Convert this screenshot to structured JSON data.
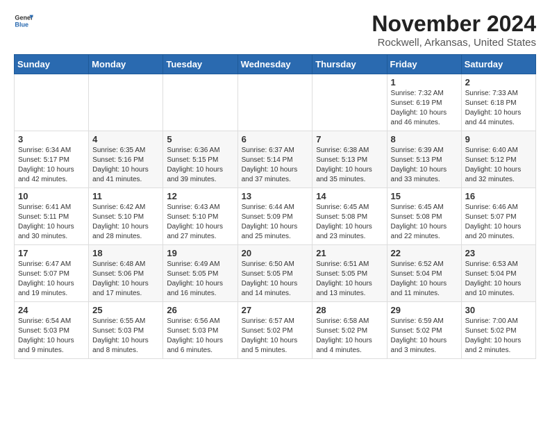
{
  "header": {
    "logo_general": "General",
    "logo_blue": "Blue",
    "month": "November 2024",
    "location": "Rockwell, Arkansas, United States"
  },
  "weekdays": [
    "Sunday",
    "Monday",
    "Tuesday",
    "Wednesday",
    "Thursday",
    "Friday",
    "Saturday"
  ],
  "weeks": [
    [
      {
        "day": "",
        "info": ""
      },
      {
        "day": "",
        "info": ""
      },
      {
        "day": "",
        "info": ""
      },
      {
        "day": "",
        "info": ""
      },
      {
        "day": "",
        "info": ""
      },
      {
        "day": "1",
        "info": "Sunrise: 7:32 AM\nSunset: 6:19 PM\nDaylight: 10 hours\nand 46 minutes."
      },
      {
        "day": "2",
        "info": "Sunrise: 7:33 AM\nSunset: 6:18 PM\nDaylight: 10 hours\nand 44 minutes."
      }
    ],
    [
      {
        "day": "3",
        "info": "Sunrise: 6:34 AM\nSunset: 5:17 PM\nDaylight: 10 hours\nand 42 minutes."
      },
      {
        "day": "4",
        "info": "Sunrise: 6:35 AM\nSunset: 5:16 PM\nDaylight: 10 hours\nand 41 minutes."
      },
      {
        "day": "5",
        "info": "Sunrise: 6:36 AM\nSunset: 5:15 PM\nDaylight: 10 hours\nand 39 minutes."
      },
      {
        "day": "6",
        "info": "Sunrise: 6:37 AM\nSunset: 5:14 PM\nDaylight: 10 hours\nand 37 minutes."
      },
      {
        "day": "7",
        "info": "Sunrise: 6:38 AM\nSunset: 5:13 PM\nDaylight: 10 hours\nand 35 minutes."
      },
      {
        "day": "8",
        "info": "Sunrise: 6:39 AM\nSunset: 5:13 PM\nDaylight: 10 hours\nand 33 minutes."
      },
      {
        "day": "9",
        "info": "Sunrise: 6:40 AM\nSunset: 5:12 PM\nDaylight: 10 hours\nand 32 minutes."
      }
    ],
    [
      {
        "day": "10",
        "info": "Sunrise: 6:41 AM\nSunset: 5:11 PM\nDaylight: 10 hours\nand 30 minutes."
      },
      {
        "day": "11",
        "info": "Sunrise: 6:42 AM\nSunset: 5:10 PM\nDaylight: 10 hours\nand 28 minutes."
      },
      {
        "day": "12",
        "info": "Sunrise: 6:43 AM\nSunset: 5:10 PM\nDaylight: 10 hours\nand 27 minutes."
      },
      {
        "day": "13",
        "info": "Sunrise: 6:44 AM\nSunset: 5:09 PM\nDaylight: 10 hours\nand 25 minutes."
      },
      {
        "day": "14",
        "info": "Sunrise: 6:45 AM\nSunset: 5:08 PM\nDaylight: 10 hours\nand 23 minutes."
      },
      {
        "day": "15",
        "info": "Sunrise: 6:45 AM\nSunset: 5:08 PM\nDaylight: 10 hours\nand 22 minutes."
      },
      {
        "day": "16",
        "info": "Sunrise: 6:46 AM\nSunset: 5:07 PM\nDaylight: 10 hours\nand 20 minutes."
      }
    ],
    [
      {
        "day": "17",
        "info": "Sunrise: 6:47 AM\nSunset: 5:07 PM\nDaylight: 10 hours\nand 19 minutes."
      },
      {
        "day": "18",
        "info": "Sunrise: 6:48 AM\nSunset: 5:06 PM\nDaylight: 10 hours\nand 17 minutes."
      },
      {
        "day": "19",
        "info": "Sunrise: 6:49 AM\nSunset: 5:05 PM\nDaylight: 10 hours\nand 16 minutes."
      },
      {
        "day": "20",
        "info": "Sunrise: 6:50 AM\nSunset: 5:05 PM\nDaylight: 10 hours\nand 14 minutes."
      },
      {
        "day": "21",
        "info": "Sunrise: 6:51 AM\nSunset: 5:05 PM\nDaylight: 10 hours\nand 13 minutes."
      },
      {
        "day": "22",
        "info": "Sunrise: 6:52 AM\nSunset: 5:04 PM\nDaylight: 10 hours\nand 11 minutes."
      },
      {
        "day": "23",
        "info": "Sunrise: 6:53 AM\nSunset: 5:04 PM\nDaylight: 10 hours\nand 10 minutes."
      }
    ],
    [
      {
        "day": "24",
        "info": "Sunrise: 6:54 AM\nSunset: 5:03 PM\nDaylight: 10 hours\nand 9 minutes."
      },
      {
        "day": "25",
        "info": "Sunrise: 6:55 AM\nSunset: 5:03 PM\nDaylight: 10 hours\nand 8 minutes."
      },
      {
        "day": "26",
        "info": "Sunrise: 6:56 AM\nSunset: 5:03 PM\nDaylight: 10 hours\nand 6 minutes."
      },
      {
        "day": "27",
        "info": "Sunrise: 6:57 AM\nSunset: 5:02 PM\nDaylight: 10 hours\nand 5 minutes."
      },
      {
        "day": "28",
        "info": "Sunrise: 6:58 AM\nSunset: 5:02 PM\nDaylight: 10 hours\nand 4 minutes."
      },
      {
        "day": "29",
        "info": "Sunrise: 6:59 AM\nSunset: 5:02 PM\nDaylight: 10 hours\nand 3 minutes."
      },
      {
        "day": "30",
        "info": "Sunrise: 7:00 AM\nSunset: 5:02 PM\nDaylight: 10 hours\nand 2 minutes."
      }
    ]
  ]
}
